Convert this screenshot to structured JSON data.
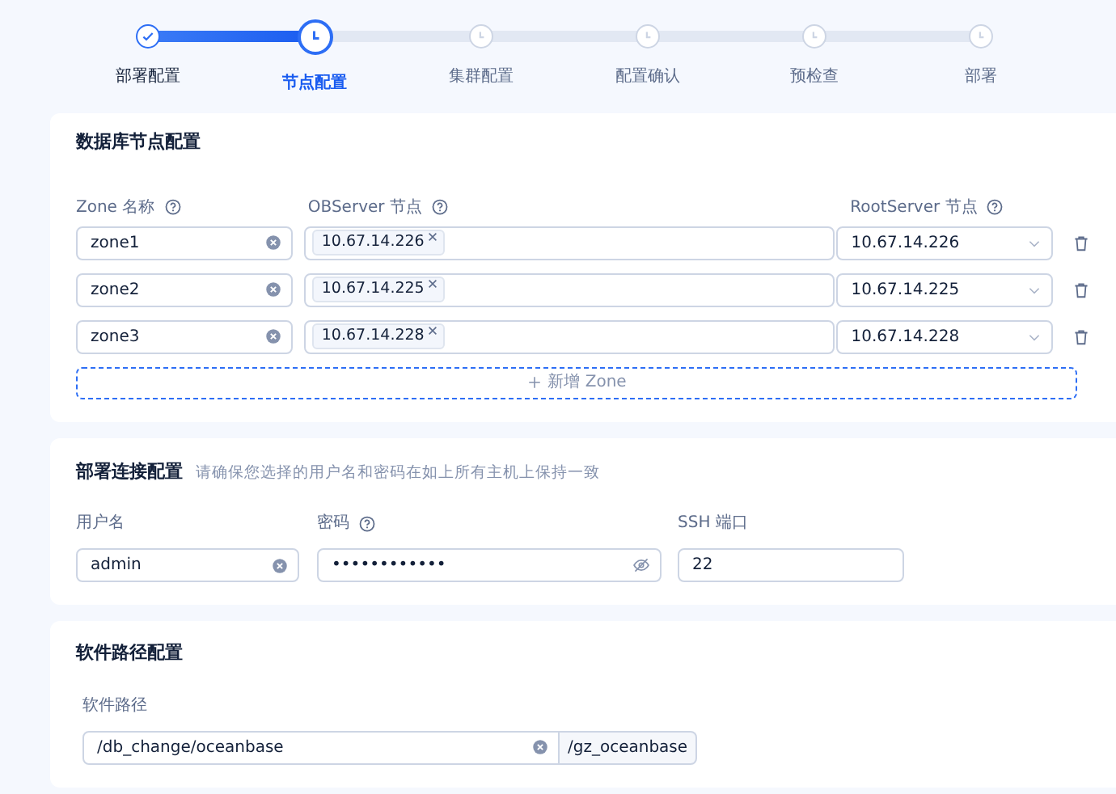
{
  "steps": [
    {
      "label": "部署配置",
      "completed": true,
      "selected": false
    },
    {
      "label": "节点配置",
      "completed": false,
      "selected": true
    },
    {
      "label": "集群配置",
      "completed": false,
      "selected": false
    },
    {
      "label": "配置确认",
      "completed": false,
      "selected": false
    },
    {
      "label": "预检查",
      "completed": false,
      "selected": false
    },
    {
      "label": "部署",
      "completed": false,
      "selected": false
    }
  ],
  "database_nodes": {
    "title": "数据库节点配置",
    "columns": [
      {
        "label": "Zone 名称",
        "help": true
      },
      {
        "label": "OBServer 节点",
        "help": true
      },
      {
        "label": "RootServer 节点",
        "help": true
      }
    ],
    "rows": [
      {
        "zone": "zone1",
        "observers": [
          "10.67.14.226"
        ],
        "rootserver": "10.67.14.226"
      },
      {
        "zone": "zone2",
        "observers": [
          "10.67.14.225"
        ],
        "rootserver": "10.67.14.225"
      },
      {
        "zone": "zone3",
        "observers": [
          "10.67.14.228"
        ],
        "rootserver": "10.67.14.228"
      }
    ],
    "add_button": "新增 Zone"
  },
  "connection": {
    "title": "部署连接配置",
    "hint": "请确保您选择的用户名和密码在如上所有主机上保持一致",
    "fields": [
      {
        "label": "用户名",
        "help": false,
        "kind": "clearable",
        "value": "admin"
      },
      {
        "label": "密码",
        "help": true,
        "kind": "password",
        "value": "••••••••••••"
      },
      {
        "label": "SSH 端口",
        "help": false,
        "kind": "plain",
        "value": "22"
      }
    ]
  },
  "software_path": {
    "title": "软件路径配置",
    "label": "软件路径",
    "value": "/db_change/oceanbase",
    "suffix": "/gz_oceanbase"
  }
}
